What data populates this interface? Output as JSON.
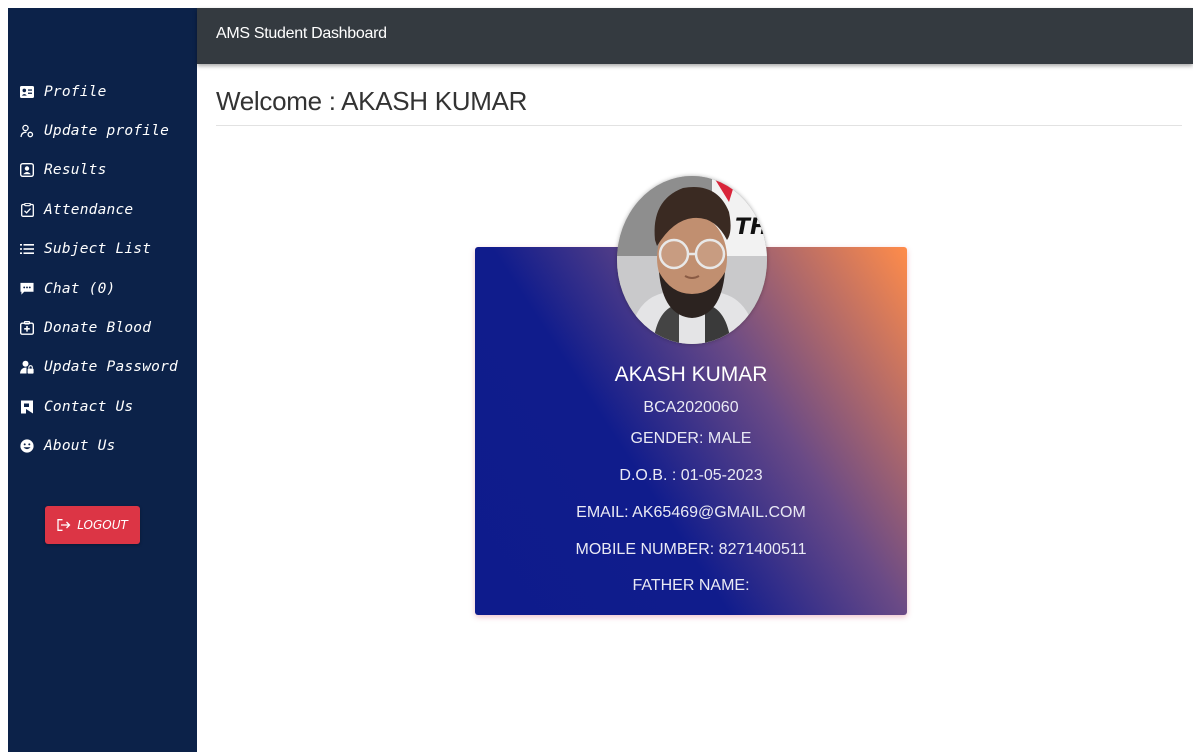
{
  "header": {
    "brand": "AMS Student Dashboard"
  },
  "sidebar": {
    "items": [
      {
        "label": "Profile",
        "icon": "id-card-icon"
      },
      {
        "label": "Update profile",
        "icon": "user-gear-icon"
      },
      {
        "label": "Results",
        "icon": "portrait-icon"
      },
      {
        "label": "Attendance",
        "icon": "clipboard-check-icon"
      },
      {
        "label": "Subject List",
        "icon": "list-icon"
      },
      {
        "label": "Chat (0)",
        "icon": "chat-icon"
      },
      {
        "label": "Donate Blood",
        "icon": "medical-kit-icon"
      },
      {
        "label": "Update Password",
        "icon": "user-lock-icon"
      },
      {
        "label": "Contact Us",
        "icon": "contact-icon"
      },
      {
        "label": "About Us",
        "icon": "smile-icon"
      }
    ],
    "logout_label": "LOGOUT",
    "logout_icon": "sign-out-icon"
  },
  "main": {
    "welcome": "Welcome : AKASH KUMAR"
  },
  "profile": {
    "name": "AKASH KUMAR",
    "id": "BCA2020060",
    "gender": "GENDER: MALE",
    "dob": "D.O.B. : 01-05-2023",
    "email": "EMAIL: AK65469@GMAIL.COM",
    "mobile": "MOBILE NUMBER: 8271400511",
    "father": "FATHER NAME:",
    "photo_text": "THE"
  },
  "colors": {
    "sidebar_bg": "#0c2249",
    "topbar_bg": "#343a40",
    "logout_bg": "#dc3545",
    "card_gradient_start": "#0e1b8c",
    "card_gradient_end": "#ff8c4a"
  }
}
